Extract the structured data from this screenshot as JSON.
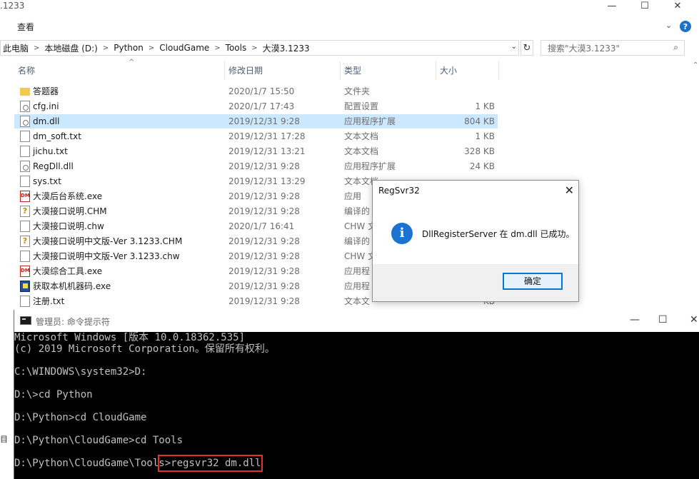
{
  "explorer": {
    "window_title": ".1233",
    "controls": {
      "minimize": "—",
      "maximize": "☐",
      "close": "✕"
    },
    "ribbon": {
      "view_tab": "查看",
      "collapse": "⌄",
      "help": "?"
    },
    "address": {
      "breadcrumbs": [
        "此电脑",
        "本地磁盘 (D:)",
        "Python",
        "CloudGame",
        "Tools",
        "大漠3.1233"
      ],
      "dropdown": "⌄",
      "refresh": "↻"
    },
    "search": {
      "placeholder": "搜索\"大漠3.1233\"",
      "icon": "search-icon"
    },
    "columns": {
      "name": "名称",
      "modified": "修改日期",
      "type": "类型",
      "size": "大小"
    },
    "files": [
      {
        "name": "答题器",
        "modified": "2020/1/7 15:50",
        "type": "文件夹",
        "size": "",
        "icon": "folder"
      },
      {
        "name": "cfg.ini",
        "modified": "2020/1/7 17:43",
        "type": "配置设置",
        "size": "1 KB",
        "icon": "gear"
      },
      {
        "name": "dm.dll",
        "modified": "2019/12/31 9:28",
        "type": "应用程序扩展",
        "size": "804 KB",
        "icon": "gear",
        "selected": true
      },
      {
        "name": "dm_soft.txt",
        "modified": "2019/12/31 17:28",
        "type": "文本文档",
        "size": "1 KB",
        "icon": "file"
      },
      {
        "name": "jichu.txt",
        "modified": "2019/12/31 13:21",
        "type": "文本文档",
        "size": "328 KB",
        "icon": "file"
      },
      {
        "name": "RegDll.dll",
        "modified": "2019/12/31 9:28",
        "type": "应用程序扩展",
        "size": "24 KB",
        "icon": "gear"
      },
      {
        "name": "sys.txt",
        "modified": "2019/12/31 13:29",
        "type": "文本文档",
        "size": "",
        "icon": "file"
      },
      {
        "name": "大漠后台系统.exe",
        "modified": "2019/12/31 9:28",
        "type": "应用",
        "size": "",
        "icon": "dm"
      },
      {
        "name": "大漠接口说明.CHM",
        "modified": "2019/12/31 9:28",
        "type": "编译的",
        "size": "",
        "icon": "chm"
      },
      {
        "name": "大漠接口说明.chw",
        "modified": "2020/1/7 16:41",
        "type": "CHW 文",
        "size": "",
        "icon": "file"
      },
      {
        "name": "大漠接口说明中文版-Ver 3.1233.CHM",
        "modified": "2019/12/31 9:28",
        "type": "编译的",
        "size": "",
        "icon": "chm"
      },
      {
        "name": "大漠接口说明中文版-Ver 3.1233.chw",
        "modified": "2019/12/31 9:28",
        "type": "CHW 文",
        "size": "",
        "icon": "file"
      },
      {
        "name": "大漠综合工具.exe",
        "modified": "2019/12/31 9:28",
        "type": "应用程",
        "size": "",
        "icon": "dm"
      },
      {
        "name": "获取本机机器码.exe",
        "modified": "2019/12/31 9:28",
        "type": "应用程",
        "size": "",
        "icon": "app"
      },
      {
        "name": "注册.txt",
        "modified": "2019/12/31 9:28",
        "type": "文本文",
        "size": "KB",
        "icon": "file"
      }
    ],
    "left_stub_bottom": "目"
  },
  "dialog": {
    "title": "RegSvr32",
    "close": "✕",
    "icon": "info-icon",
    "message": "DllRegisterServer 在 dm.dll 已成功。",
    "ok_label": "确定"
  },
  "cmd": {
    "title": "管理员: 命令提示符",
    "controls": {
      "minimize": "—",
      "maximize": "☐",
      "close": "✕"
    },
    "lines": [
      "Microsoft Windows [版本 10.0.18362.535]",
      "(c) 2019 Microsoft Corporation。保留所有权利。",
      "",
      "C:\\WINDOWS\\system32>D:",
      "",
      "D:\\>cd Python",
      "",
      "D:\\Python>cd CloudGame",
      "",
      "D:\\Python\\CloudGame>cd Tools",
      "",
      "D:\\Python\\CloudGame\\Tools>regsvr32 dm.dll"
    ]
  },
  "colors": {
    "selection": "#cce8ff",
    "accent": "#0078d7",
    "highlight_box": "#e53030",
    "cmd_bg": "#000000",
    "cmd_text": "#c0c0c0"
  }
}
